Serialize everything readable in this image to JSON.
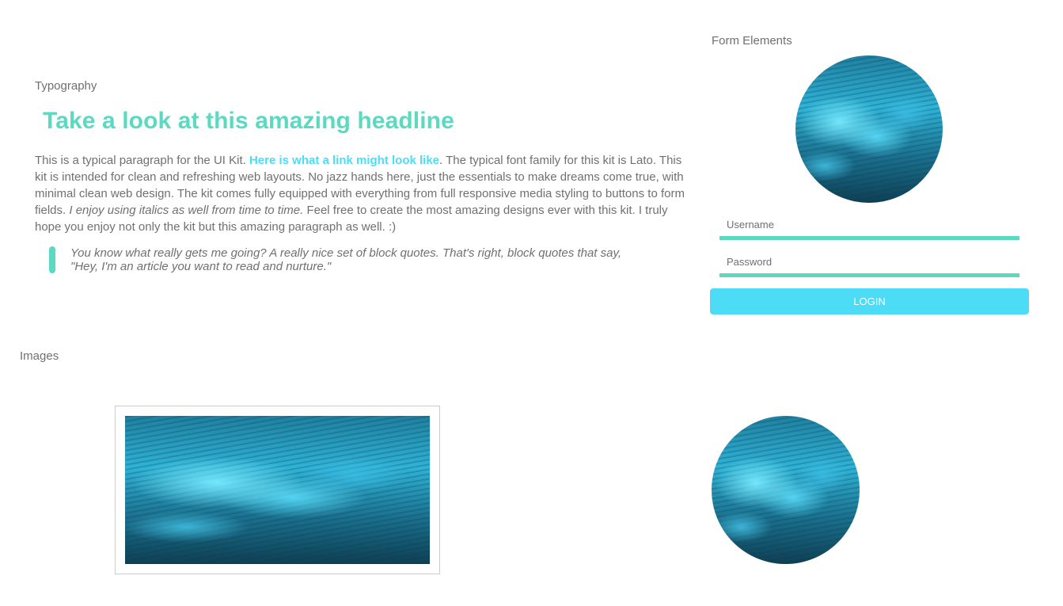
{
  "typography": {
    "section_label": "Typography",
    "headline": "Take a look at this amazing headline",
    "paragraph": {
      "part1": "This is a typical paragraph for the UI Kit. ",
      "link": "Here is what a link might look like",
      "part2": ". The typical font family for this kit is Lato. This kit is intended for clean and refreshing web layouts. No jazz hands here, just the essentials to make dreams come true, with minimal clean web design. The kit comes fully equipped with everything from full responsive media styling to buttons to form fields. ",
      "italic": "I enjoy using italics as well from time to time.",
      "part3": " Feel free to create the most amazing designs ever with this kit. I truly hope you enjoy not only the kit but this amazing paragraph as well. :)"
    },
    "blockquote": "You know what really gets me going? A really nice set of block quotes. That's right, block quotes that say, \"Hey, I'm an article you want to read and nurture.\""
  },
  "form": {
    "section_label": "Form Elements",
    "username_placeholder": "Username",
    "password_placeholder": "Password",
    "login_label": "LOGIN"
  },
  "images": {
    "section_label": "Images"
  },
  "colors": {
    "accent_green": "#5bd9c1",
    "accent_blue": "#4ddcf6",
    "text_gray": "#707070"
  }
}
